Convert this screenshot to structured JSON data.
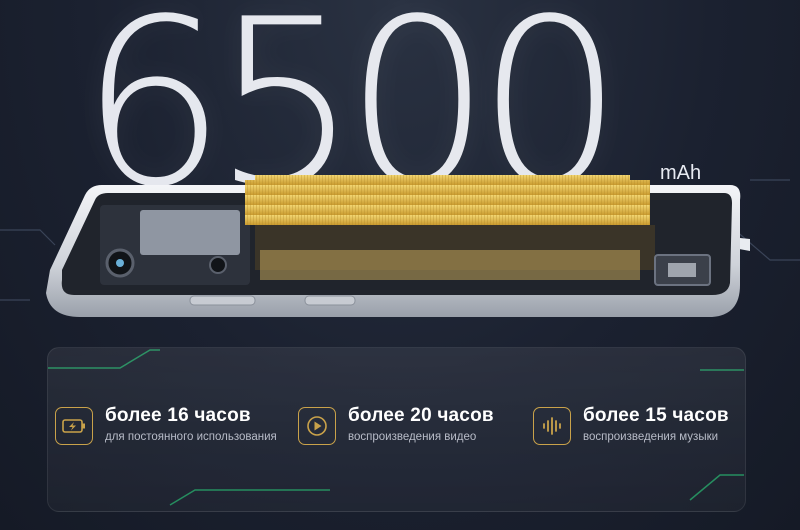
{
  "hero": {
    "capacity": "6500",
    "unit": "mAh"
  },
  "features": [
    {
      "icon": "battery-charging-icon",
      "title": "более 16 часов",
      "subtitle": "для постоянного использования"
    },
    {
      "icon": "video-play-icon",
      "title": "более 20 часов",
      "subtitle": "воспроизведения видео"
    },
    {
      "icon": "audio-wave-icon",
      "title": "более 15 часов",
      "subtitle": "воспроизведения музыки"
    }
  ],
  "colors": {
    "background": "#1b2130",
    "accent_gold": "#c9a24a",
    "battery_gold": "#e8c45a",
    "circuit_green": "#1f8a5a"
  }
}
